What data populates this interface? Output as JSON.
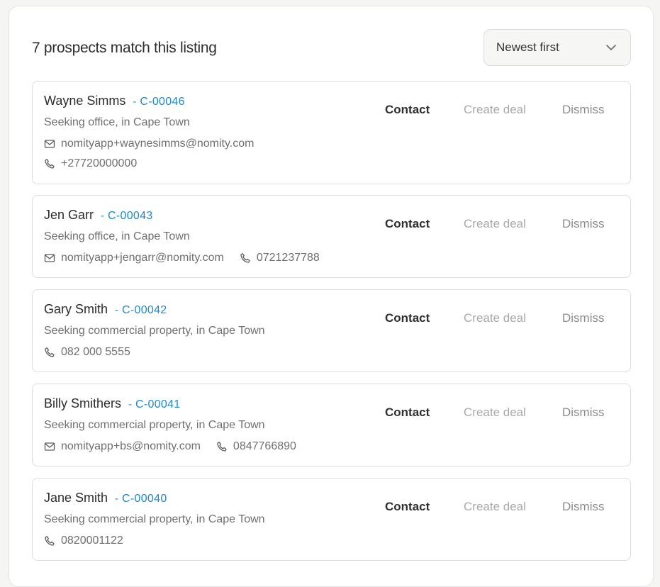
{
  "header": {
    "title": "7 prospects match this listing",
    "sort_label": "Newest first"
  },
  "actions": {
    "contact": "Contact",
    "create_deal": "Create deal",
    "dismiss": "Dismiss"
  },
  "icons": {
    "email": "mail-icon",
    "phone": "phone-icon",
    "sort": "chevron-down-icon"
  },
  "colors": {
    "accent": "#1a8bd0",
    "muted": "#6f6f6f",
    "disabled": "#a9a9a9"
  },
  "prospects": [
    {
      "name": "Wayne Simms",
      "separator": "-",
      "code": "C-00046",
      "seeking": "Seeking office, in Cape Town",
      "email": "nomityapp+waynesimms@nomity.com",
      "phone": "+27720000000"
    },
    {
      "name": "Jen Garr",
      "separator": "-",
      "code": "C-00043",
      "seeking": "Seeking office, in Cape Town",
      "email": "nomityapp+jengarr@nomity.com",
      "phone": "0721237788"
    },
    {
      "name": "Gary Smith",
      "separator": "-",
      "code": "C-00042",
      "seeking": "Seeking commercial property, in Cape Town",
      "phone": "082 000 5555"
    },
    {
      "name": "Billy Smithers",
      "separator": "-",
      "code": "C-00041",
      "seeking": "Seeking commercial property, in Cape Town",
      "email": "nomityapp+bs@nomity.com",
      "phone": "0847766890"
    },
    {
      "name": "Jane Smith",
      "separator": "-",
      "code": "C-00040",
      "seeking": "Seeking commercial property, in Cape Town",
      "phone": "0820001122"
    }
  ]
}
